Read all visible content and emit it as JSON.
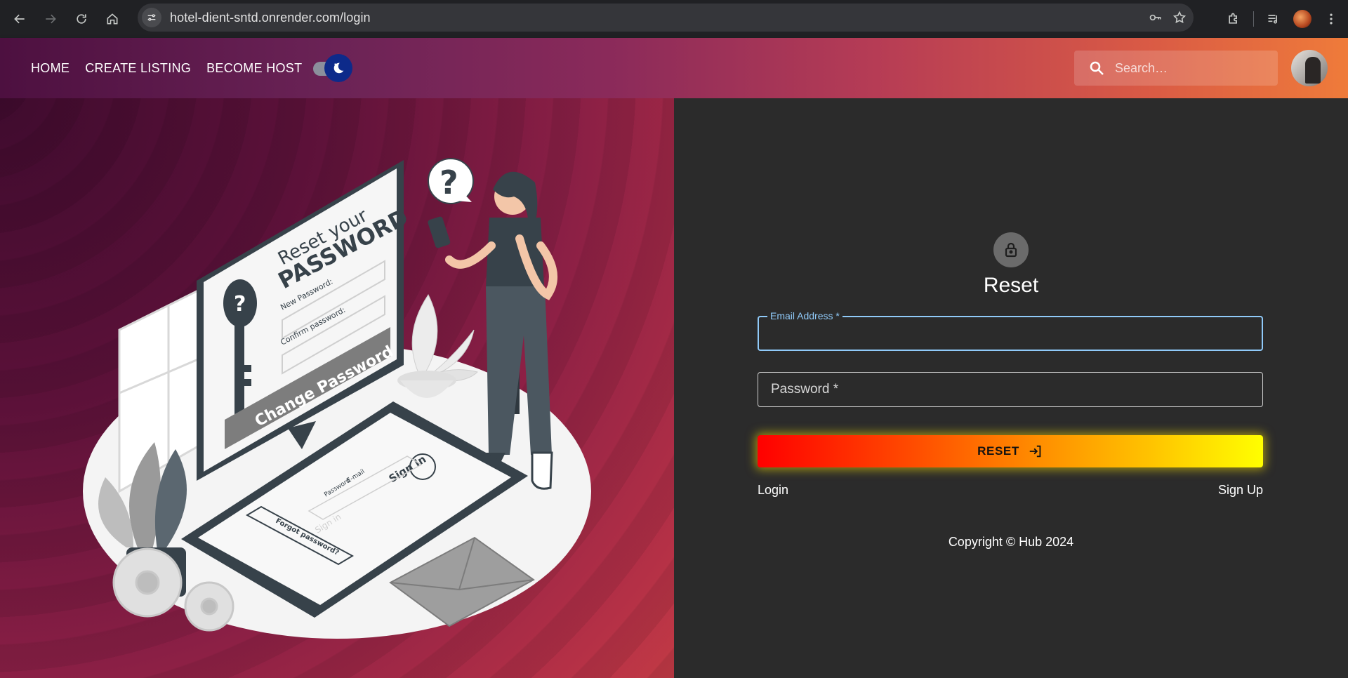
{
  "browser": {
    "url": "hotel-dient-sntd.onrender.com/login"
  },
  "header": {
    "nav": [
      "HOME",
      "CREATE LISTING",
      "BECOME HOST"
    ],
    "search_placeholder": "Search…",
    "theme_toggle": "dark"
  },
  "illustration": {
    "reset_line1": "Reset your",
    "reset_line2": "PASSWORD",
    "new_password_label": "New Password:",
    "confirm_password_label": "Confirm password:",
    "change_password_button": "Change Password",
    "phone_title": "Sign In",
    "phone_email": "E-mail",
    "phone_password": "Password",
    "phone_signin": "Sign in",
    "phone_forgot": "Forgot password?"
  },
  "form": {
    "title": "Reset",
    "email_label": "Email Address *",
    "password_label": "Password *",
    "reset_button": "RESET",
    "login_link": "Login",
    "signup_link": "Sign Up",
    "copyright": "Copyright © Hub 2024"
  },
  "colors": {
    "accent_field": "#90caf9",
    "button_start": "#ff0000",
    "button_end": "#ffff00"
  }
}
